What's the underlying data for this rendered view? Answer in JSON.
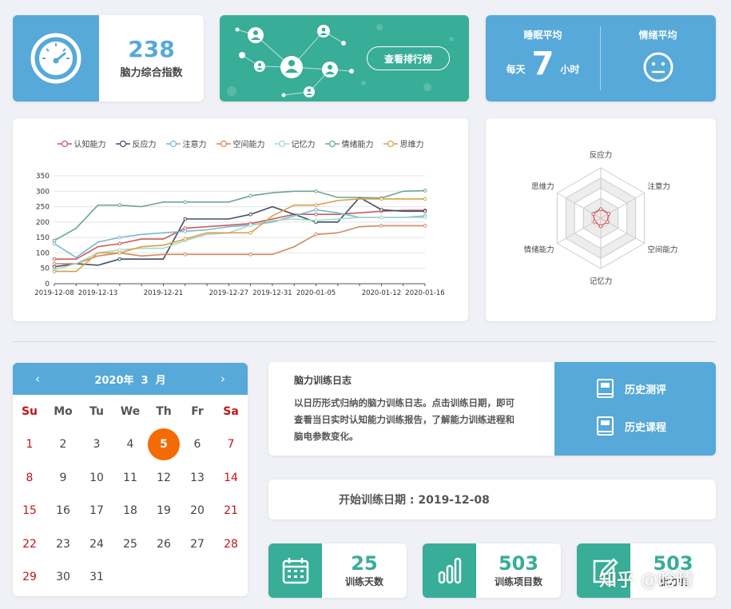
{
  "stats": {
    "brain_index": {
      "value": "238",
      "label": "脑力综合指数",
      "icon": "speedometer-icon"
    },
    "ranking_button": "查看排行榜",
    "sleep": {
      "title": "睡眠平均",
      "prefix": "每天",
      "value": "7",
      "unit": "小时"
    },
    "mood": {
      "title": "情绪平均",
      "icon": "neutral-face-icon"
    }
  },
  "chart_data": [
    {
      "type": "line",
      "x": [
        "2019-12-08",
        "2019-12-10",
        "2019-12-13",
        "2019-12-16",
        "2019-12-18",
        "2019-12-21",
        "2019-12-23",
        "2019-12-25",
        "2019-12-27",
        "2019-12-29",
        "2019-12-31",
        "2020-01-02",
        "2020-01-05",
        "2020-01-08",
        "2020-01-10",
        "2020-01-12",
        "2020-01-14",
        "2020-01-16"
      ],
      "x_ticks": [
        "2019-12-08",
        "2019-12-13",
        "2019-12-21",
        "2019-12-27",
        "2019-12-31",
        "2020-01-05",
        "2020-01-12",
        "2020-01-16"
      ],
      "ylim": [
        0,
        350
      ],
      "y_ticks": [
        0,
        50,
        100,
        150,
        200,
        250,
        300,
        350
      ],
      "legend_position": "top",
      "grid": true,
      "series": [
        {
          "name": "认知能力",
          "color": "#c95c5c",
          "values": [
            80,
            80,
            120,
            130,
            145,
            145,
            180,
            185,
            190,
            195,
            210,
            225,
            225,
            225,
            230,
            235,
            238,
            238
          ]
        },
        {
          "name": "反应力",
          "color": "#40506a",
          "values": [
            55,
            65,
            60,
            80,
            80,
            80,
            210,
            210,
            210,
            225,
            250,
            225,
            200,
            200,
            280,
            240,
            235,
            235
          ]
        },
        {
          "name": "注意力",
          "color": "#7ab8d4",
          "values": [
            130,
            85,
            135,
            150,
            160,
            165,
            170,
            175,
            185,
            190,
            200,
            220,
            240,
            230,
            215,
            215,
            215,
            220
          ]
        },
        {
          "name": "空间能力",
          "color": "#d4895e",
          "values": [
            65,
            65,
            90,
            100,
            90,
            95,
            95,
            95,
            95,
            95,
            95,
            120,
            160,
            165,
            185,
            188,
            188,
            188
          ]
        },
        {
          "name": "记忆力",
          "color": "#a6d9c9",
          "values": [
            45,
            65,
            100,
            110,
            115,
            115,
            140,
            160,
            165,
            190,
            205,
            210,
            205,
            210,
            215,
            215,
            215,
            215
          ]
        },
        {
          "name": "情绪能力",
          "color": "#6fa693",
          "values": [
            140,
            180,
            255,
            255,
            250,
            265,
            265,
            265,
            265,
            285,
            295,
            300,
            300,
            280,
            280,
            278,
            300,
            302
          ]
        },
        {
          "name": "思维力",
          "color": "#d9a04a",
          "values": [
            40,
            40,
            100,
            100,
            120,
            125,
            145,
            165,
            165,
            165,
            220,
            255,
            255,
            270,
            275,
            275,
            275,
            275
          ]
        }
      ]
    },
    {
      "type": "radar",
      "axes": [
        "反应力",
        "注意力",
        "空间能力",
        "记忆力",
        "情绪能力",
        "思维力"
      ],
      "values": [
        0.18,
        0.18,
        0.15,
        0.16,
        0.14,
        0.17
      ],
      "color": "#c95c5c"
    }
  ],
  "calendar": {
    "title": "2020年  3  月",
    "prev": "‹",
    "next": "›",
    "weekdays": [
      "Su",
      "Mo",
      "Tu",
      "We",
      "Th",
      "Fr",
      "Sa"
    ],
    "weeks": [
      [
        "1",
        "2",
        "3",
        "4",
        "5",
        "6",
        "7"
      ],
      [
        "8",
        "9",
        "10",
        "11",
        "12",
        "13",
        "14"
      ],
      [
        "15",
        "16",
        "17",
        "18",
        "19",
        "20",
        "21"
      ],
      [
        "22",
        "23",
        "24",
        "25",
        "26",
        "27",
        "28"
      ],
      [
        "29",
        "30",
        "31",
        "",
        "",
        "",
        ""
      ]
    ],
    "selected": "5"
  },
  "log": {
    "title": "脑力训练日志",
    "desc_line1": "以日历形式归纳的脑力训练日志。点击训练日期，即可",
    "desc_line2": "查看当日实时认知能力训练报告，了解能力训练进程和",
    "desc_line3": "脑电参数变化。",
    "history_eval": "历史测评",
    "history_course": "历史课程"
  },
  "start": {
    "text": "开始训练日期 : 2019-12-08"
  },
  "bottom": {
    "days": {
      "value": "25",
      "label": "训练天数",
      "icon": "calendar-icon"
    },
    "items": {
      "value": "503",
      "label": "训练项目数",
      "icon": "bar-chart-icon"
    },
    "third": {
      "value": "503",
      "label": "能力项",
      "icon": "edit-icon"
    }
  },
  "watermark": "知乎 @晗晴"
}
